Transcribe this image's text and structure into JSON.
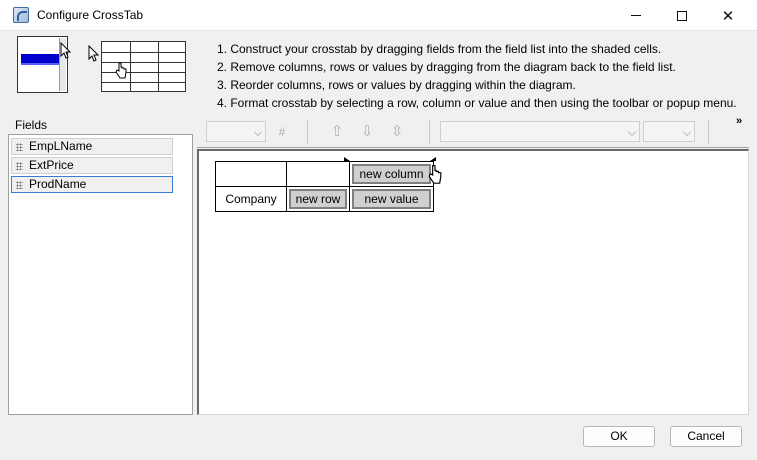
{
  "window": {
    "title": "Configure CrossTab"
  },
  "instructions": [
    "1. Construct your crosstab by dragging fields from the field list into the shaded cells.",
    "2. Remove columns, rows or values by dragging from the diagram back to the field list.",
    "3. Reorder columns, rows or values by dragging within the diagram.",
    "4. Format crosstab by selecting a row, column or value and then using the toolbar or popup menu."
  ],
  "fields": {
    "label": "Fields",
    "items": [
      "EmpLName",
      "ExtPrice",
      "ProdName"
    ],
    "selected_index": 2
  },
  "toolbar": {
    "more": "»"
  },
  "crosstab": {
    "row_field": "Company",
    "new_column": "new column",
    "new_row": "new row",
    "new_value": "new value"
  },
  "buttons": {
    "ok": "OK",
    "cancel": "Cancel"
  }
}
